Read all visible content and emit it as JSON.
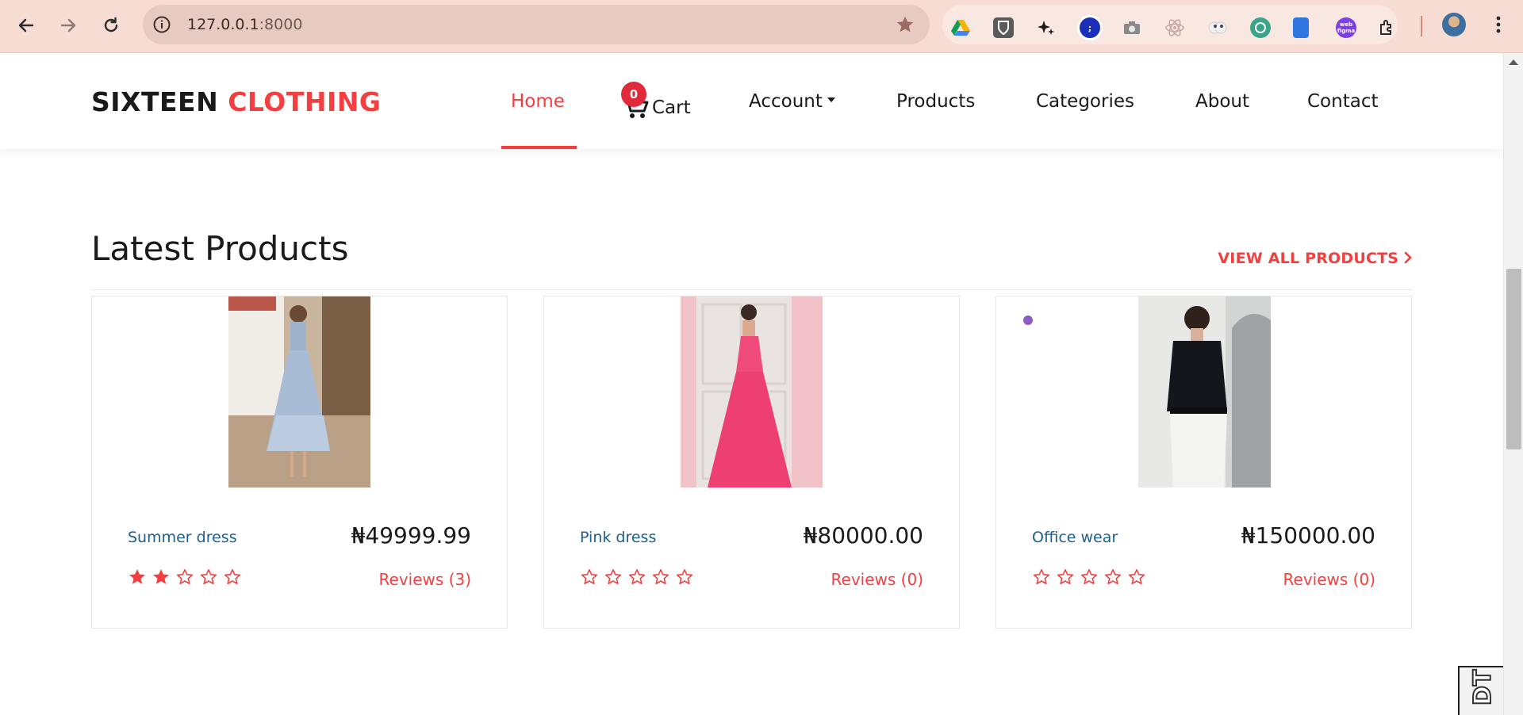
{
  "browser": {
    "url_host": "127.0.0.1",
    "url_port": ":8000",
    "extensions": [
      "google-drive-icon",
      "bitwarden-icon",
      "sparkle-icon",
      "translate-icon",
      "camera-icon",
      "react-devtools-icon",
      "eyes-icon",
      "globe-icon",
      "phone-icon",
      "webtofigma-icon",
      "puzzle-icon"
    ],
    "ext_labels": {
      "webtofigma": "web figma"
    }
  },
  "site": {
    "logo_part1": "SIXTEEN",
    "logo_part2": "CLOTHING",
    "nav": {
      "home": "Home",
      "cart_count": "0",
      "cart": "Cart",
      "account": "Account",
      "products": "Products",
      "categories": "Categories",
      "about": "About",
      "contact": "Contact"
    }
  },
  "section": {
    "title": "Latest Products",
    "view_all": "VIEW ALL PRODUCTS"
  },
  "products": [
    {
      "name": "Summer dress",
      "price": "₦49999.99",
      "rating": 2,
      "reviews": "Reviews (3)"
    },
    {
      "name": "Pink dress",
      "price": "₦80000.00",
      "rating": 0,
      "reviews": "Reviews (0)"
    },
    {
      "name": "Office wear",
      "price": "₦150000.00",
      "rating": 0,
      "reviews": "Reviews (0)"
    }
  ],
  "corner_badge": "DT",
  "colors": {
    "accent": "#f33f3f",
    "product_link": "#1f5f8b",
    "chrome_bg": "#f6dcd3"
  }
}
